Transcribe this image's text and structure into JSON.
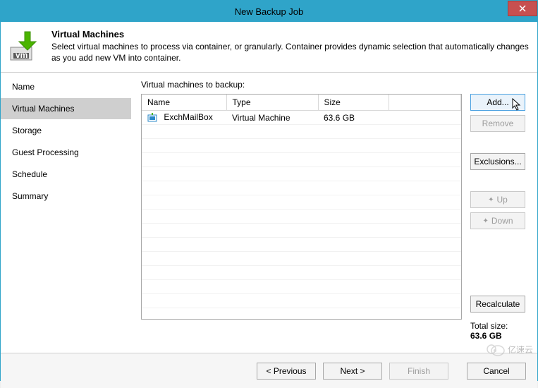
{
  "window": {
    "title": "New Backup Job"
  },
  "header": {
    "title": "Virtual Machines",
    "description": "Select virtual machines to process via container, or granularly. Container provides dynamic selection that automatically changes as you add new VM into container."
  },
  "sidebar": {
    "items": [
      {
        "label": "Name"
      },
      {
        "label": "Virtual Machines"
      },
      {
        "label": "Storage"
      },
      {
        "label": "Guest Processing"
      },
      {
        "label": "Schedule"
      },
      {
        "label": "Summary"
      }
    ],
    "selected_index": 1
  },
  "content": {
    "label": "Virtual machines to backup:",
    "columns": {
      "name": "Name",
      "type": "Type",
      "size": "Size"
    },
    "rows": [
      {
        "name": "ExchMailBox",
        "type": "Virtual Machine",
        "size": "63.6 GB"
      }
    ],
    "buttons": {
      "add": "Add...",
      "remove": "Remove",
      "exclusions": "Exclusions...",
      "up": "Up",
      "down": "Down",
      "recalculate": "Recalculate"
    },
    "totals": {
      "label": "Total size:",
      "value": "63.6 GB"
    }
  },
  "footer": {
    "previous": "< Previous",
    "next": "Next >",
    "finish": "Finish",
    "cancel": "Cancel"
  },
  "watermark": "亿速云"
}
